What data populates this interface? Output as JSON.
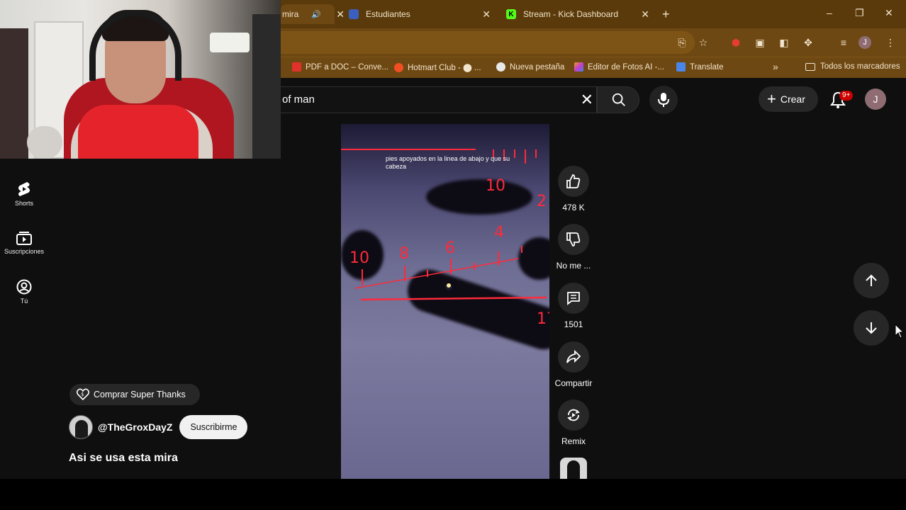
{
  "browser": {
    "tabs": [
      {
        "label": "mira",
        "favicon_color": "#ff0000",
        "active": true
      },
      {
        "label": "Estudiantes",
        "favicon_color": "#3b5fc0",
        "active": false
      },
      {
        "label": "Stream - Kick Dashboard",
        "favicon_color": "#53fc18",
        "favicon_letter": "K",
        "active": false
      }
    ],
    "close_glyph": "✕",
    "new_tab_glyph": "+",
    "window_controls": [
      "–",
      "❐",
      "✕"
    ],
    "bookmarks": [
      {
        "label": "PDF a DOC – Conve...",
        "color": "#e0312b"
      },
      {
        "label": "Hotmart Club - ⬤ ...",
        "color": "#f04e23"
      },
      {
        "label": "Nueva pestaña",
        "color": "#e8e8e8"
      },
      {
        "label": "Editor de Fotos AI -...",
        "color": "#e3a018"
      },
      {
        "label": "Translate",
        "color": "#4a86e8"
      }
    ],
    "bookmarks_overflow": "»",
    "all_bookmarks": "Todos los marcadores",
    "profile_initial": "J"
  },
  "youtube": {
    "search_value": "of man",
    "create_label": "Crear",
    "notifications_badge": "9+",
    "avatar_initial": "J",
    "guide": [
      {
        "label": "Shorts",
        "icon": "shorts-icon"
      },
      {
        "label": "Suscripciones",
        "icon": "subscriptions-icon"
      },
      {
        "label": "Tú",
        "icon": "you-icon"
      }
    ],
    "video": {
      "caption": "pies apoyados en la linea de abajo y que su cabeza",
      "scope_numbers": [
        "10",
        "2",
        "4",
        "10",
        "8",
        "6",
        "17"
      ]
    },
    "actions": {
      "like_count": "478 K",
      "dislike_label": "No me ...",
      "comments_count": "1501",
      "share_label": "Compartir",
      "remix_label": "Remix"
    },
    "super_thanks_label": "Comprar Super Thanks",
    "channel_name": "@TheGroxDayZ",
    "subscribe_label": "Suscribirme",
    "video_title": "Asi se usa esta mira"
  }
}
